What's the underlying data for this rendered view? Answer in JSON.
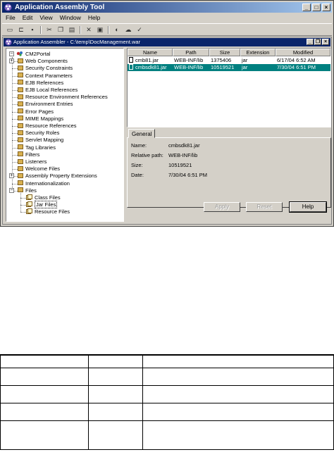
{
  "app": {
    "title": "Application Assembly Tool",
    "menu": [
      "File",
      "Edit",
      "View",
      "Window",
      "Help"
    ],
    "toolbar_icons": [
      "new-icon",
      "open-icon",
      "save-icon",
      "cut-icon",
      "copy-icon",
      "paste-icon",
      "delete-icon",
      "properties-icon",
      "generate-icon",
      "deploy-icon",
      "verify-icon"
    ]
  },
  "inner_window": {
    "title": "Application Assembler - C:\\temp\\DocManagement.war"
  },
  "tree": {
    "root": "CM2Portal",
    "items": [
      "Web Components",
      "Security Constraints",
      "Context Parameters",
      "EJB References",
      "EJB Local References",
      "Resource Environment References",
      "Environment Entries",
      "Error Pages",
      "MIME Mappings",
      "Resource References",
      "Security Roles",
      "Servlet Mapping",
      "Tag Libraries",
      "Filters",
      "Listeners",
      "Welcome Files",
      "Assembly Property Extensions",
      "Internationalization",
      "Files"
    ],
    "files_children": [
      "Class Files",
      "Jar Files",
      "Resource Files"
    ]
  },
  "grid": {
    "headers": [
      "Name",
      "Path",
      "Size",
      "Extension",
      "Modified"
    ],
    "rows": [
      [
        "cmb81.jar",
        "WEB-INF/lib",
        "1375406",
        "jar",
        "6/17/04 6:52 AM"
      ],
      [
        "cmbsdk81.jar",
        "WEB-INF/lib",
        "10519521",
        "jar",
        "7/30/04 6:51 PM"
      ]
    ]
  },
  "details": {
    "tab": "General",
    "name_label": "Name:",
    "name_value": "cmbsdk81.jar",
    "path_label": "Relative path:",
    "path_value": "WEB-INF/lib",
    "size_label": "Size:",
    "size_value": "10519521",
    "date_label": "Date:",
    "date_value": "7/30/04 6:51 PM"
  },
  "buttons": {
    "apply": "Apply",
    "reset": "Reset",
    "help": "Help"
  },
  "colors": {
    "title_gradient_start": "#0a246a",
    "title_gradient_end": "#a6caf0",
    "selection": "#008080",
    "face": "#d4d0c8"
  }
}
